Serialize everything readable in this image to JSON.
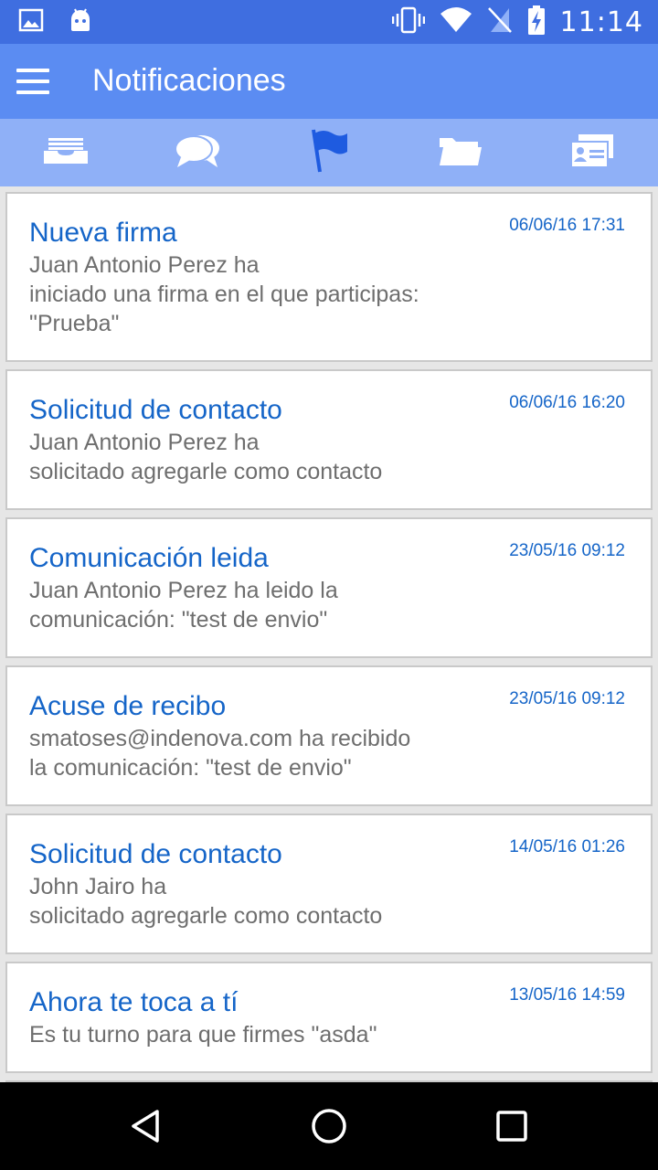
{
  "status_bar": {
    "time": "11:14",
    "icons": [
      "image-icon",
      "android-icon",
      "vibrate-icon",
      "wifi-icon",
      "no-sim-icon",
      "battery-charging-icon"
    ]
  },
  "app_bar": {
    "title": "Notificaciones",
    "menu_icon": "hamburger-menu-icon"
  },
  "tabs": [
    {
      "icon": "inbox-tray-icon"
    },
    {
      "icon": "chat-bubbles-icon"
    },
    {
      "icon": "flag-icon",
      "active": true
    },
    {
      "icon": "folder-icon"
    },
    {
      "icon": "contact-card-icon"
    }
  ],
  "colors": {
    "status_bar": "#3f6ee0",
    "app_bar": "#5b8cf2",
    "tab_bar": "#8fb0f7",
    "accent_text": "#1565c8",
    "body_text": "#6e6e6e",
    "active_tab_icon": "#1e5be0"
  },
  "notifications": [
    {
      "title": "Nueva firma",
      "date": "06/06/16 17:31",
      "text": "Juan Antonio Perez ha\niniciado una firma en el que participas:\n\"Prueba\""
    },
    {
      "title": "Solicitud de contacto",
      "date": "06/06/16 16:20",
      "text": "Juan Antonio Perez ha\nsolicitado agregarle como contacto"
    },
    {
      "title": "Comunicación leida",
      "date": "23/05/16 09:12",
      "text": "Juan Antonio Perez ha leido la\ncomunicación: \"test de envio\""
    },
    {
      "title": "Acuse de recibo",
      "date": "23/05/16 09:12",
      "text": "smatoses@indenova.com ha recibido\nla comunicación: \"test de envio\""
    },
    {
      "title": "Solicitud de contacto",
      "date": "14/05/16 01:26",
      "text": "John Jairo ha\nsolicitado agregarle como contacto"
    },
    {
      "title": "Ahora te toca a tí",
      "date": "13/05/16 14:59",
      "text": "Es tu turno para que firmes \"asda\""
    }
  ],
  "nav_bar": {
    "icons": [
      "back-icon",
      "home-icon",
      "recents-icon"
    ]
  }
}
